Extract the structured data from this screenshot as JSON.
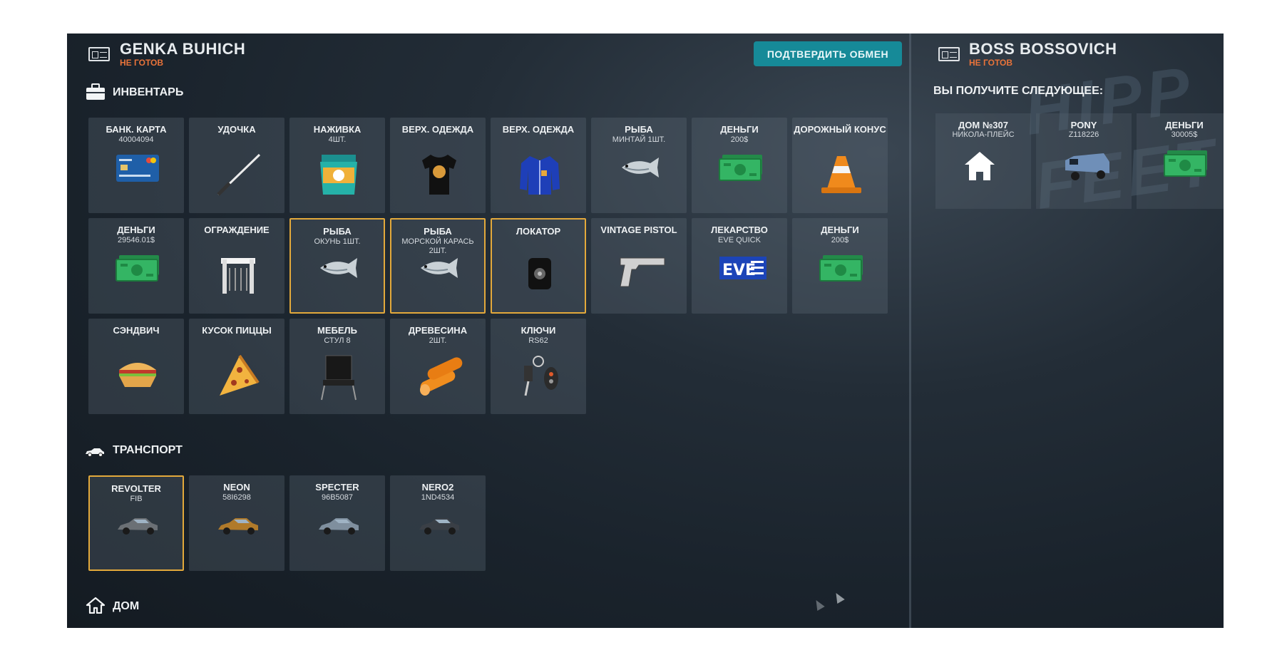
{
  "left_player": {
    "name": "GENKA BUHICH",
    "status": "НЕ ГОТОВ"
  },
  "right_player": {
    "name": "BOSS BOSSOVICH",
    "status": "НЕ ГОТОВ"
  },
  "confirm_button": "ПОДТВЕРДИТЬ ОБМЕН",
  "sections": {
    "inventory": "ИНВЕНТАРЬ",
    "transport": "ТРАНСПОРТ",
    "house": "ДОМ",
    "receive": "ВЫ ПОЛУЧИТЕ СЛЕДУЮЩЕЕ:"
  },
  "background_sign": "HIPP FEET",
  "inventory": [
    {
      "title": "БАНК. КАРТА",
      "sub": "40004094",
      "icon": "bank-card-icon",
      "selected": false
    },
    {
      "title": "УДОЧКА",
      "sub": "",
      "icon": "fishing-rod-icon",
      "selected": false
    },
    {
      "title": "НАЖИВКА",
      "sub": "4ШТ.",
      "icon": "bait-bag-icon",
      "selected": false
    },
    {
      "title": "ВЕРХ. ОДЕЖДА",
      "sub": "",
      "icon": "tshirt-icon",
      "selected": false
    },
    {
      "title": "ВЕРХ. ОДЕЖДА",
      "sub": "",
      "icon": "jacket-icon",
      "selected": false
    },
    {
      "title": "РЫБА",
      "sub": "МИНТАЙ 1ШТ.",
      "icon": "fish-icon",
      "selected": false
    },
    {
      "title": "ДЕНЬГИ",
      "sub": "200$",
      "icon": "money-icon",
      "selected": false
    },
    {
      "title": "ДОРОЖНЫЙ КОНУС",
      "sub": "",
      "icon": "traffic-cone-icon",
      "selected": false
    },
    {
      "title": "ДЕНЬГИ",
      "sub": "29546.01$",
      "icon": "money-icon",
      "selected": false
    },
    {
      "title": "ОГРАЖДЕНИЕ",
      "sub": "",
      "icon": "barrier-icon",
      "selected": false
    },
    {
      "title": "РЫБА",
      "sub": "ОКУНЬ 1ШТ.",
      "icon": "fish-icon",
      "selected": true
    },
    {
      "title": "РЫБА",
      "sub": "МОРСКОЙ КАРАСЬ 2ШТ.",
      "icon": "fish-icon",
      "selected": true
    },
    {
      "title": "ЛОКАТОР",
      "sub": "",
      "icon": "locator-icon",
      "selected": true
    },
    {
      "title": "VINTAGE PISTOL",
      "sub": "",
      "icon": "pistol-icon",
      "selected": false
    },
    {
      "title": "ЛЕКАРСТВО",
      "sub": "EVE QUICK",
      "icon": "medicine-icon",
      "selected": false
    },
    {
      "title": "ДЕНЬГИ",
      "sub": "200$",
      "icon": "money-icon",
      "selected": false
    },
    {
      "title": "СЭНДВИЧ",
      "sub": "",
      "icon": "sandwich-icon",
      "selected": false
    },
    {
      "title": "КУСОК ПИЦЦЫ",
      "sub": "",
      "icon": "pizza-icon",
      "selected": false
    },
    {
      "title": "МЕБЕЛЬ",
      "sub": "СТУЛ 8",
      "icon": "chair-icon",
      "selected": false
    },
    {
      "title": "ДРЕВЕСИНА",
      "sub": "2ШТ.",
      "icon": "wood-icon",
      "selected": false
    },
    {
      "title": "КЛЮЧИ",
      "sub": "RS62",
      "icon": "keys-icon",
      "selected": false
    }
  ],
  "transport": [
    {
      "title": "REVOLTER",
      "sub": "FIB",
      "icon": "car-icon",
      "selected": true,
      "color": "#6b7075"
    },
    {
      "title": "NEON",
      "sub": "58I6298",
      "icon": "car-icon",
      "selected": false,
      "color": "#b07a2a"
    },
    {
      "title": "SPECTER",
      "sub": "96B5087",
      "icon": "car-icon",
      "selected": false,
      "color": "#7f8f9e"
    },
    {
      "title": "NERO2",
      "sub": "1ND4534",
      "icon": "car-icon",
      "selected": false,
      "color": "#3a3f46"
    }
  ],
  "receive": [
    {
      "title": "ДОМ №307",
      "sub": "НИКОЛА-ПЛЕЙС",
      "icon": "house-icon"
    },
    {
      "title": "PONY",
      "sub": "Z118226",
      "icon": "van-icon"
    },
    {
      "title": "ДЕНЬГИ",
      "sub": "30005$",
      "icon": "money-icon"
    }
  ],
  "colors": {
    "accent_orange": "#e8733a",
    "confirm_teal": "#168a98",
    "selected_border": "#e3a93b",
    "money_green": "#2fa55a"
  }
}
